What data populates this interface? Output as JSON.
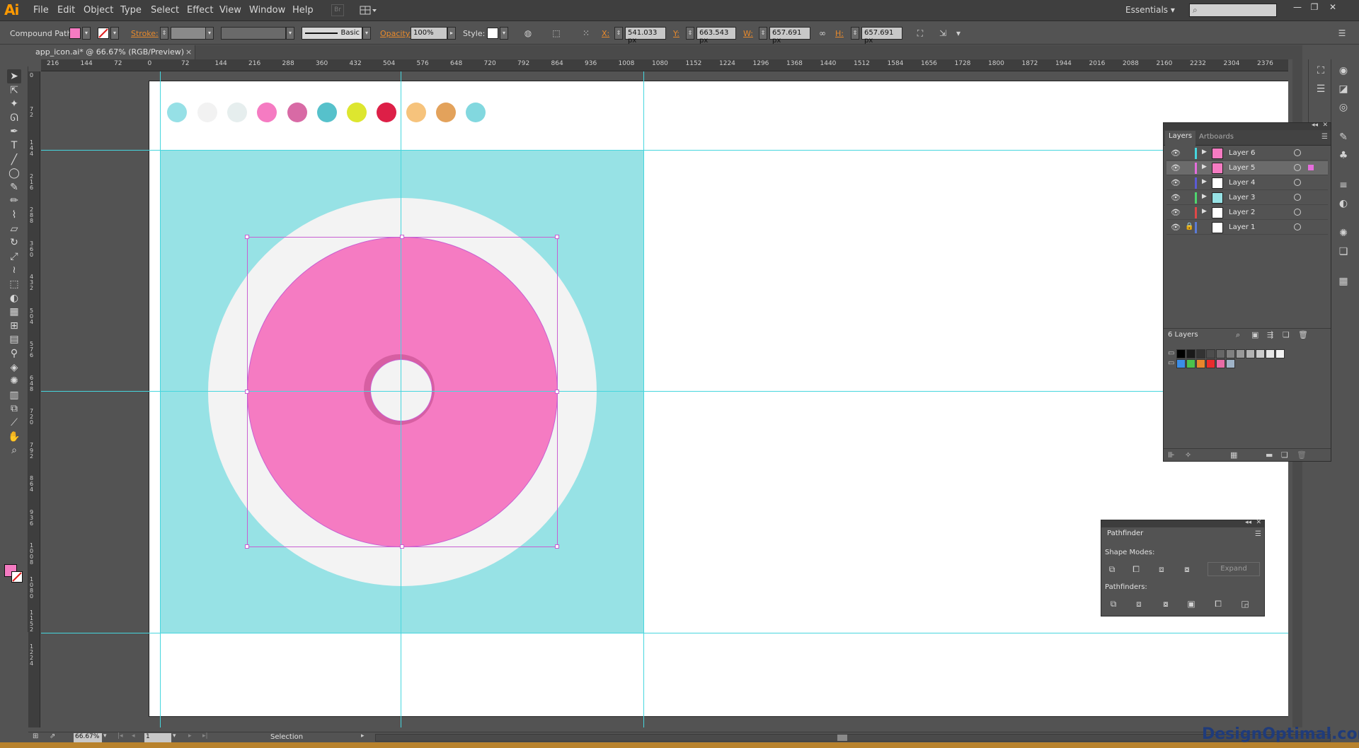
{
  "app": {
    "logo": "Ai",
    "menus": [
      "File",
      "Edit",
      "Object",
      "Type",
      "Select",
      "Effect",
      "View",
      "Window",
      "Help"
    ],
    "workspace": "Essentials",
    "bridge_label": "Br"
  },
  "control_bar": {
    "selection_type": "Compound Path",
    "fill_color": "#f57bc2",
    "stroke_label": "Stroke:",
    "stroke_profile": "Basic",
    "opacity_label": "Opacity:",
    "opacity_value": "100%",
    "style_label": "Style:",
    "x_label": "X:",
    "x_value": "541.033 px",
    "y_label": "Y:",
    "y_value": "663.543 px",
    "w_label": "W:",
    "w_value": "657.691 px",
    "h_label": "H:",
    "h_value": "657.691 px"
  },
  "document_tab": {
    "title": "app_icon.ai* @ 66.67% (RGB/Preview)",
    "close": "×"
  },
  "rulers": {
    "top_ticks": [
      "216",
      "144",
      "72",
      "0",
      "72",
      "144",
      "216",
      "288",
      "360",
      "432",
      "504",
      "576",
      "648",
      "720",
      "792",
      "864",
      "936",
      "1008",
      "1080",
      "1152",
      "1224",
      "1296",
      "1368",
      "1440",
      "1512",
      "1584",
      "1656",
      "1728",
      "1800",
      "1872",
      "1944",
      "2016",
      "2088",
      "2160",
      "2232",
      "2304",
      "2376"
    ],
    "left_ticks": [
      "0",
      "72",
      "144",
      "216",
      "288",
      "360",
      "432",
      "504",
      "576",
      "648",
      "720",
      "792",
      "864",
      "936",
      "1008",
      "1080",
      "1152",
      "1224"
    ]
  },
  "tools": [
    "selection-tool",
    "direct-selection-tool",
    "magic-wand-tool",
    "lasso-tool",
    "pen-tool",
    "type-tool",
    "line-tool",
    "ellipse-tool",
    "paintbrush-tool",
    "pencil-tool",
    "blob-brush-tool",
    "eraser-tool",
    "rotate-tool",
    "scale-tool",
    "warp-tool",
    "free-transform-tool",
    "shape-builder-tool",
    "perspective-grid-tool",
    "mesh-tool",
    "gradient-tool",
    "eyedropper-tool",
    "blend-tool",
    "symbol-sprayer-tool",
    "column-graph-tool",
    "artboard-tool",
    "slice-tool",
    "hand-tool",
    "zoom-tool"
  ],
  "artwork": {
    "palette": [
      "#96e0e6",
      "#f2f2f2",
      "#e6eeee",
      "#f57bc2",
      "#d86aa5",
      "#56c1cb",
      "#dde62f",
      "#dd1f47",
      "#f6c37c",
      "#e3a25b",
      "#82d8df"
    ],
    "background_color": "#97e2e5",
    "outer_circle_color": "#f3f3f3",
    "donut_color": "#f57bc2",
    "shadow_color": "#d75fa2"
  },
  "layers_panel": {
    "tabs": [
      "Layers",
      "Artboards"
    ],
    "layers": [
      {
        "name": "Layer 6",
        "color": "#46d6de",
        "thumb": "#f57bc2",
        "selected": false,
        "locked": false
      },
      {
        "name": "Layer 5",
        "color": "#e56ddc",
        "thumb": "#f57bc2",
        "selected": true,
        "locked": false
      },
      {
        "name": "Layer 4",
        "color": "#5b5bd6",
        "thumb": "#ffffff",
        "selected": false,
        "locked": false
      },
      {
        "name": "Layer 3",
        "color": "#4fd66f",
        "thumb": "#97e2e5",
        "selected": false,
        "locked": false
      },
      {
        "name": "Layer 2",
        "color": "#e04848",
        "thumb": "#ffffff",
        "selected": false,
        "locked": false
      },
      {
        "name": "Layer 1",
        "color": "#5b7bd6",
        "thumb": "#ffffff",
        "selected": false,
        "locked": true
      }
    ],
    "count_label": "6 Layers",
    "swatches_row1": [
      "#000000",
      "#1a1a1a",
      "#333333",
      "#4d4d4d",
      "#666666",
      "#808080",
      "#999999",
      "#b3b3b3",
      "#cccccc",
      "#e6e6e6",
      "#f2f2f2"
    ],
    "swatches_row2": [
      "#3b8ee8",
      "#4cc24c",
      "#e8862c",
      "#e82c2c",
      "#e86ca6",
      "#a0b4c8"
    ]
  },
  "pathfinder": {
    "title": "Pathfinder",
    "shape_modes_label": "Shape Modes:",
    "pathfinders_label": "Pathfinders:",
    "expand_label": "Expand"
  },
  "status_bar": {
    "zoom": "66.67%",
    "page": "1",
    "status": "Selection"
  },
  "watermark": "DesignOptimal.com"
}
